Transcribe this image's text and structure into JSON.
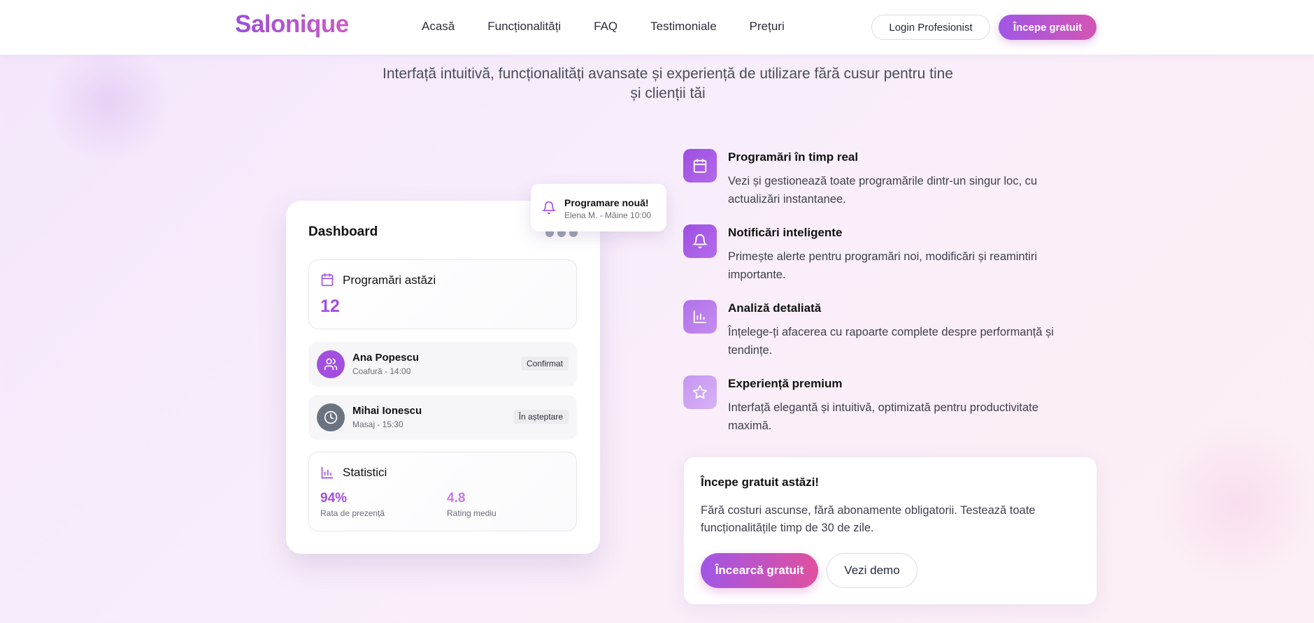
{
  "brand": {
    "logo_text": "Salonique"
  },
  "nav": {
    "links": [
      "Acasă",
      "Funcționalități",
      "FAQ",
      "Testimoniale",
      "Prețuri"
    ],
    "login_label": "Login Profesionist",
    "start_label": "Începe gratuit"
  },
  "hero": {
    "subtitle": "Interfață intuitivă, funcționalități avansate și experiență de utilizare fără cusur pentru tine și clienții tăi"
  },
  "dashboard": {
    "title": "Dashboard",
    "today": {
      "label": "Programări astăzi",
      "count": "12"
    },
    "appointments": [
      {
        "name": "Ana Popescu",
        "meta": "Coafură - 14:00",
        "status": "Confirmat",
        "icon": "users-icon"
      },
      {
        "name": "Mihai Ionescu",
        "meta": "Masaj - 15:30",
        "status": "În așteptare",
        "icon": "clock-icon"
      }
    ],
    "stats": {
      "label": "Statistici",
      "items": [
        {
          "value": "94%",
          "label": "Rata de prezență"
        },
        {
          "value": "4.8",
          "label": "Rating mediu"
        }
      ]
    }
  },
  "notification": {
    "title": "Programare nouă!",
    "subtitle": "Elena M. - Mâine 10:00",
    "icon": "bell-icon"
  },
  "features": [
    {
      "title": "Programări în timp real",
      "description": "Vezi și gestionează toate programările dintr-un singur loc, cu actualizări instantanee.",
      "icon": "calendar-icon"
    },
    {
      "title": "Notificări inteligente",
      "description": "Primește alerte pentru programări noi, modificări și reamintiri importante.",
      "icon": "bell-icon"
    },
    {
      "title": "Analiză detaliată",
      "description": "Înțelege-ți afacerea cu rapoarte complete despre performanță și tendințe.",
      "icon": "chart-icon"
    },
    {
      "title": "Experiență premium",
      "description": "Interfață elegantă și intuitivă, optimizată pentru productivitate maximă.",
      "icon": "star-icon"
    }
  ],
  "cta": {
    "title": "Începe gratuit astăzi!",
    "description": "Fără costuri ascunse, fără abonamente obligatorii. Testează toate funcționalitățile timp de 30 de zile.",
    "primary_label": "Încearcă gratuit",
    "secondary_label": "Vezi demo"
  },
  "colors": {
    "accent": "#a24fe0",
    "accent_pink": "#d455b4",
    "background": "#f6ebfa"
  }
}
